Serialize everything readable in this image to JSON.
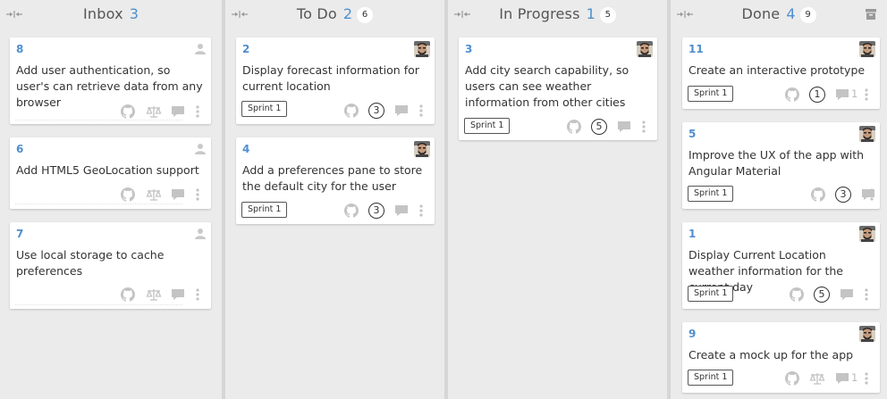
{
  "columns": [
    {
      "title": "Inbox",
      "count": "3",
      "limit": ""
    },
    {
      "title": "To Do",
      "count": "2",
      "limit": "6"
    },
    {
      "title": "In Progress",
      "count": "1",
      "limit": "5"
    },
    {
      "title": "Done",
      "count": "4",
      "limit": "9"
    }
  ],
  "cards": {
    "inbox": [
      {
        "number": "8",
        "title": "Add user authentication, so user's can retrieve data from any browser"
      },
      {
        "number": "6",
        "title": "Add HTML5 GeoLocation support"
      },
      {
        "number": "7",
        "title": "Use local storage to cache preferences"
      }
    ],
    "todo": [
      {
        "number": "2",
        "title": "Display forecast information for current location",
        "sprint": "Sprint 1",
        "estimate": "3"
      },
      {
        "number": "4",
        "title": "Add a preferences pane to store the default city for the user",
        "sprint": "Sprint 1",
        "estimate": "3"
      }
    ],
    "inprogress": [
      {
        "number": "3",
        "title": "Add city search capability, so users can see weather information from other cities",
        "sprint": "Sprint 1",
        "estimate": "5"
      }
    ],
    "done": [
      {
        "number": "11",
        "title": "Create an interactive prototype",
        "sprint": "Sprint 1",
        "estimate": "1",
        "comments": "1"
      },
      {
        "number": "5",
        "title": "Improve the UX of the app with Angular Material",
        "sprint": "Sprint 1",
        "estimate": "3"
      },
      {
        "number": "1",
        "title": "Display Current Location weather information for the current day",
        "sprint": "Sprint 1",
        "estimate": "5"
      },
      {
        "number": "9",
        "title": "Create a mock up for the app",
        "sprint": "Sprint 1",
        "comments": "1"
      }
    ]
  },
  "colors": {
    "accent": "#4f8fcf",
    "column_bg": "#ebebeb",
    "divider": "#d6d6d6",
    "icon_gray": "#c4c4c4"
  }
}
